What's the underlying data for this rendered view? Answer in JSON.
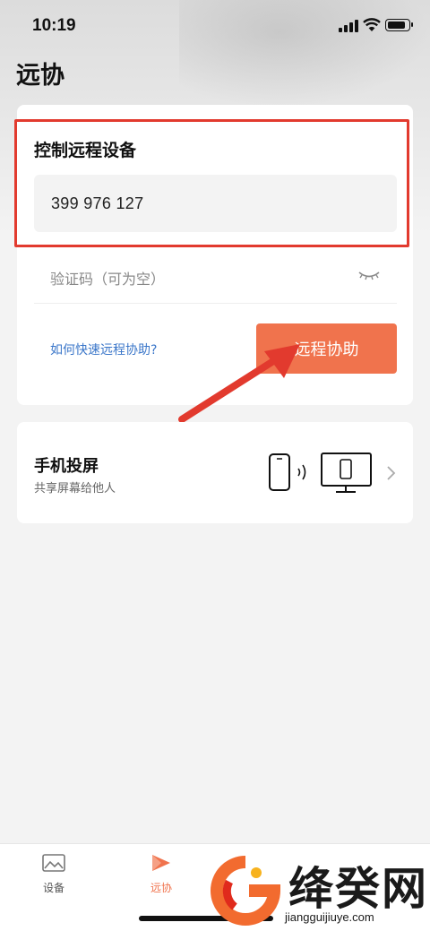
{
  "status_bar": {
    "time": "10:19"
  },
  "page": {
    "title": "远协"
  },
  "control_card": {
    "heading": "控制远程设备",
    "device_id": "399 976 127",
    "code_placeholder": "验证码（可为空）",
    "help_link": "如何快速远程协助?",
    "action_button": "远程协助"
  },
  "mirror_card": {
    "title": "手机投屏",
    "subtitle": "共享屏幕给他人"
  },
  "tabbar": {
    "items": [
      {
        "label": "设备",
        "icon": "image-icon",
        "active": false
      },
      {
        "label": "远协",
        "icon": "play-icon",
        "active": true
      }
    ]
  },
  "watermark": {
    "name": "绛癸网",
    "url": "jiangguijiuye.com"
  },
  "colors": {
    "accent": "#f0734d",
    "highlight_border": "#e23a2e",
    "link": "#3a76c9"
  }
}
